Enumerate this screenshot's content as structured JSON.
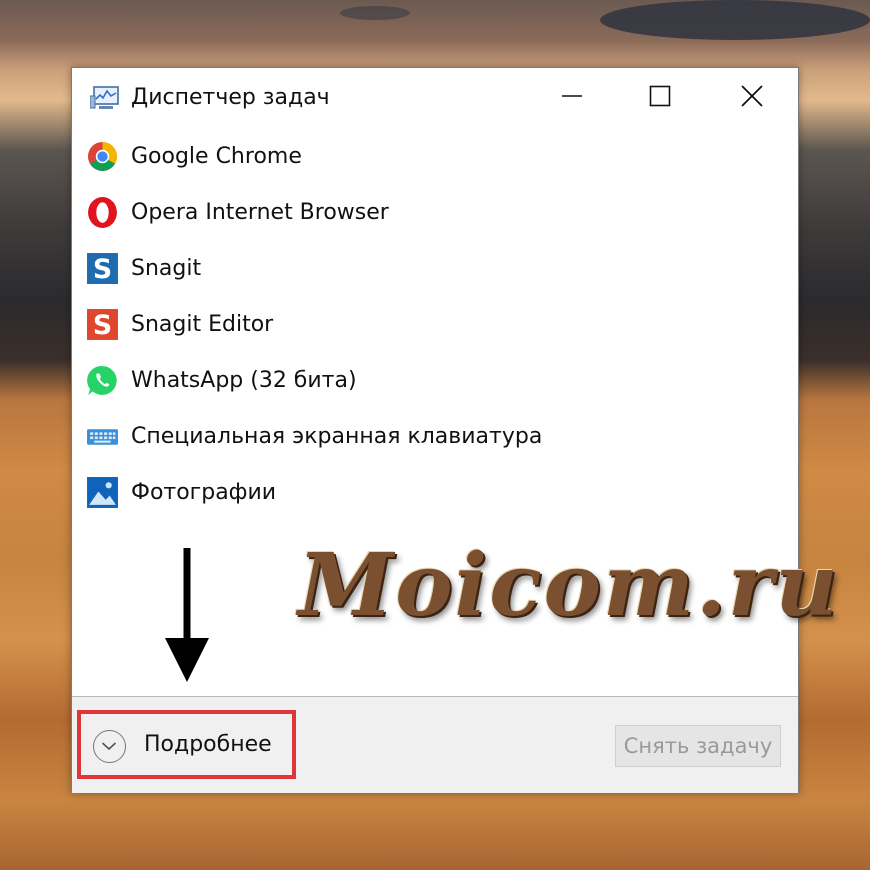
{
  "window": {
    "title": "Диспетчер задач",
    "app_icon": "task-manager-icon",
    "controls": {
      "minimize": "minimize-icon",
      "maximize": "maximize-icon",
      "close": "close-icon"
    }
  },
  "apps": [
    {
      "label": "Google Chrome",
      "icon": "chrome-icon"
    },
    {
      "label": "Opera Internet Browser",
      "icon": "opera-icon"
    },
    {
      "label": "Snagit",
      "icon": "snagit-icon"
    },
    {
      "label": "Snagit Editor",
      "icon": "snagit-editor-icon"
    },
    {
      "label": "WhatsApp (32 бита)",
      "icon": "whatsapp-icon"
    },
    {
      "label": "Специальная экранная клавиатура",
      "icon": "keyboard-icon"
    },
    {
      "label": "Фотографии",
      "icon": "photos-icon"
    }
  ],
  "footer": {
    "details_label": "Подробнее",
    "details_icon": "chevron-down-icon",
    "end_task_label": "Снять задачу"
  },
  "overlay": {
    "watermark": "Moicom.ru",
    "arrow": "arrow-down-icon",
    "highlight_color": "#e0363a"
  }
}
